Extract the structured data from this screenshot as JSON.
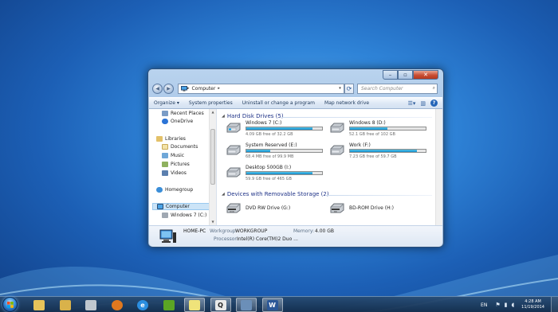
{
  "window": {
    "address": {
      "root_icon": "computer-icon",
      "path": "Computer"
    },
    "search_placeholder": "Search Computer",
    "toolbar": {
      "organize": "Organize",
      "system_properties": "System properties",
      "uninstall": "Uninstall or change a program",
      "map_network": "Map network drive"
    },
    "nav": {
      "recent_places": "Recent Places",
      "onedrive": "OneDrive",
      "libraries": "Libraries",
      "documents": "Documents",
      "music": "Music",
      "pictures": "Pictures",
      "videos": "Videos",
      "homegroup": "Homegroup",
      "computer": "Computer",
      "windows7": "Windows 7 (C:)"
    },
    "hard_disk_header": "Hard Disk Drives (5)",
    "drives": [
      {
        "name": "Windows 7 (C:)",
        "free": "4.09 GB free of 32.2 GB",
        "used_fraction": 0.87
      },
      {
        "name": "Windows 8 (D:)",
        "free": "52.1 GB free of 102 GB",
        "used_fraction": 0.49
      },
      {
        "name": "System Reserved (E:)",
        "free": "68.4 MB free of 99.9 MB",
        "used_fraction": 0.32
      },
      {
        "name": "Work (F:)",
        "free": "7.23 GB free of 59.7 GB",
        "used_fraction": 0.88
      },
      {
        "name": "Desktop 500GB (I:)",
        "free": "59.9 GB free of 465 GB",
        "used_fraction": 0.87
      }
    ],
    "removable_header": "Devices with Removable Storage (2)",
    "removable": [
      {
        "name": "DVD RW Drive (G:)"
      },
      {
        "name": "BD-ROM Drive (H:)"
      }
    ],
    "details": {
      "computer_name": "HOME-PC",
      "workgroup_label": "Workgroup:",
      "workgroup": "WORKGROUP",
      "memory_label": "Memory:",
      "memory": "4.00 GB",
      "processor_label": "Processor:",
      "processor": "Intel(R) Core(TM)2 Duo ..."
    }
  },
  "taskbar": {
    "apps": [
      "folder-icon",
      "file-explorer-icon",
      "paint-icon",
      "firefox-icon",
      "internet-explorer-icon",
      "evernote-icon",
      "sticky-notes-icon",
      "quicktime-icon",
      "window-app-icon",
      "word-icon"
    ],
    "language": "EN",
    "time": "4:28 AM",
    "date": "11/19/2014"
  },
  "colors": {
    "desktop": "#2f84d8",
    "drive_fill": "#26a0da",
    "group_header": "#1e3287",
    "taskbar": "#1d3a5c",
    "close_button": "#c94d33"
  }
}
